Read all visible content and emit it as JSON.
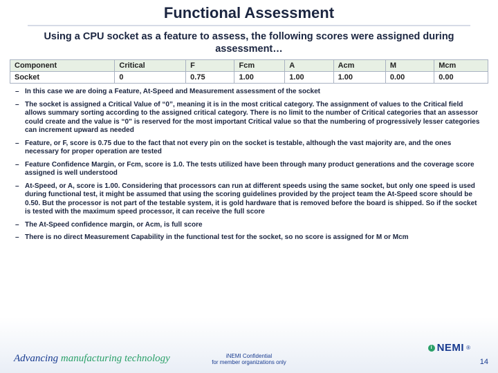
{
  "title": "Functional Assessment",
  "subtitle": "Using a CPU socket as a feature to assess, the following scores were assigned during assessment…",
  "table": {
    "headers": [
      "Component",
      "Critical",
      "F",
      "Fcm",
      "A",
      "Acm",
      "M",
      "Mcm"
    ],
    "rows": [
      {
        "cells": [
          "Socket",
          "0",
          "0.75",
          "1.00",
          "1.00",
          "1.00",
          "0.00",
          "0.00"
        ]
      }
    ]
  },
  "bullets": [
    "In this case we are doing a Feature, At-Speed and Measurement assessment of the socket",
    "The socket is assigned a Critical Value of “0”, meaning it is in the most critical category.  The assignment of values to the Critical field allows summary sorting according to the assigned critical category.  There is no limit to the number of Critical categories that an assessor could create and the value is “0” is reserved for the most important Critical value so that the numbering of progressively lesser categories can increment upward as needed",
    "Feature, or F, score is 0.75 due to the fact that not every pin on the socket is testable, although the vast majority are, and the ones necessary for proper operation are tested",
    "Feature Confidence Margin, or Fcm, score is 1.0.  The tests utilized have been through many product generations and the coverage score assigned is well understood",
    "At-Speed, or A, score is 1.00.  Considering that processors can run at different speeds using the same socket, but only one speed is used during functional test, it might be assumed that using the scoring guidelines provided by the project team the At-Speed score should be 0.50.  But the processor is not part of the testable system, it is gold hardware that is removed before the board is shipped.  So if the socket is tested with the maximum speed processor, it can receive the full score",
    "The At-Speed confidence margin, or Acm, is full score",
    "There is no direct Measurement Capability in the functional test for the socket, so no score is assigned for M or Mcm"
  ],
  "footer": {
    "tagline_adv": "Advancing ",
    "tagline_mfg": "manufacturing technology",
    "conf_line1": "iNEMI Confidential",
    "conf_line2": "for member organizations only",
    "page": "14",
    "logo_text": "NEMI",
    "logo_dot": "i"
  }
}
